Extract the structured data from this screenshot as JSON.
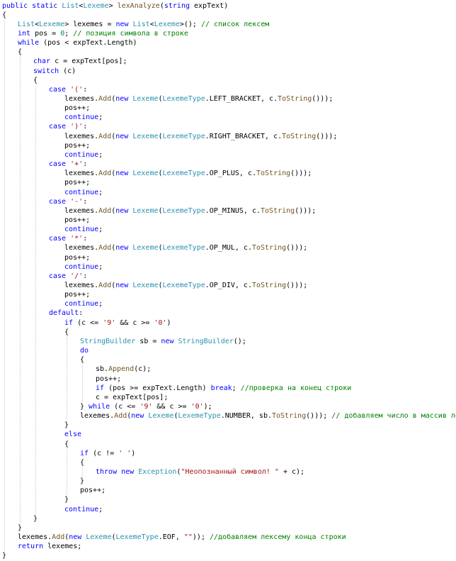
{
  "colors": {
    "background": "#ffffff",
    "plain": "#000000",
    "keyword": "#0000ff",
    "type": "#2b91af",
    "method": "#74531f",
    "string": "#a31515",
    "comment": "#008000",
    "number": "#098658",
    "guide": "#c8c8c8"
  },
  "code": {
    "lines": [
      {
        "indent": 0,
        "tokens": [
          [
            "public",
            "k"
          ],
          [
            " ",
            "p"
          ],
          [
            "static",
            "k"
          ],
          [
            " ",
            "p"
          ],
          [
            "List",
            "t"
          ],
          [
            "<",
            "p"
          ],
          [
            "Lexeme",
            "t"
          ],
          [
            "> ",
            "p"
          ],
          [
            "lexAnalyze",
            "m"
          ],
          [
            "(",
            "p"
          ],
          [
            "string",
            "k"
          ],
          [
            " expText)",
            "p"
          ]
        ]
      },
      {
        "indent": 0,
        "tokens": [
          [
            "{",
            "p"
          ]
        ]
      },
      {
        "indent": 1,
        "tokens": [
          [
            "List",
            "t"
          ],
          [
            "<",
            "p"
          ],
          [
            "Lexeme",
            "t"
          ],
          [
            "> lexemes = ",
            "p"
          ],
          [
            "new",
            "k"
          ],
          [
            " ",
            "p"
          ],
          [
            "List",
            "t"
          ],
          [
            "<",
            "p"
          ],
          [
            "Lexeme",
            "t"
          ],
          [
            ">(); ",
            "p"
          ],
          [
            "// список лексем",
            "c"
          ]
        ]
      },
      {
        "indent": 1,
        "tokens": [
          [
            "int",
            "k"
          ],
          [
            " pos = ",
            "p"
          ],
          [
            "0",
            "n"
          ],
          [
            "; ",
            "p"
          ],
          [
            "// позиция символа в строке",
            "c"
          ]
        ]
      },
      {
        "indent": 1,
        "tokens": [
          [
            "while",
            "k"
          ],
          [
            " (pos < expText.Length)",
            "p"
          ]
        ]
      },
      {
        "indent": 1,
        "tokens": [
          [
            "{",
            "p"
          ]
        ]
      },
      {
        "indent": 2,
        "tokens": [
          [
            "char",
            "k"
          ],
          [
            " c = expText[pos];",
            "p"
          ]
        ]
      },
      {
        "indent": 2,
        "tokens": [
          [
            "switch",
            "k"
          ],
          [
            " (c)",
            "p"
          ]
        ]
      },
      {
        "indent": 2,
        "tokens": [
          [
            "{",
            "p"
          ]
        ]
      },
      {
        "indent": 3,
        "tokens": [
          [
            "case",
            "k"
          ],
          [
            " ",
            "p"
          ],
          [
            "'('",
            "s"
          ],
          [
            ":",
            "p"
          ]
        ]
      },
      {
        "indent": 4,
        "tokens": [
          [
            "lexemes.",
            "p"
          ],
          [
            "Add",
            "m"
          ],
          [
            "(",
            "p"
          ],
          [
            "new",
            "k"
          ],
          [
            " ",
            "p"
          ],
          [
            "Lexeme",
            "t"
          ],
          [
            "(",
            "p"
          ],
          [
            "LexemeType",
            "t"
          ],
          [
            ".LEFT_BRACKET, c.",
            "p"
          ],
          [
            "ToString",
            "m"
          ],
          [
            "()));",
            "p"
          ]
        ]
      },
      {
        "indent": 4,
        "tokens": [
          [
            "pos++;",
            "p"
          ]
        ]
      },
      {
        "indent": 4,
        "tokens": [
          [
            "continue",
            "k"
          ],
          [
            ";",
            "p"
          ]
        ]
      },
      {
        "indent": 3,
        "tokens": [
          [
            "case",
            "k"
          ],
          [
            " ",
            "p"
          ],
          [
            "')'",
            "s"
          ],
          [
            ":",
            "p"
          ]
        ]
      },
      {
        "indent": 4,
        "tokens": [
          [
            "lexemes.",
            "p"
          ],
          [
            "Add",
            "m"
          ],
          [
            "(",
            "p"
          ],
          [
            "new",
            "k"
          ],
          [
            " ",
            "p"
          ],
          [
            "Lexeme",
            "t"
          ],
          [
            "(",
            "p"
          ],
          [
            "LexemeType",
            "t"
          ],
          [
            ".RIGHT_BRACKET, c.",
            "p"
          ],
          [
            "ToString",
            "m"
          ],
          [
            "()));",
            "p"
          ]
        ]
      },
      {
        "indent": 4,
        "tokens": [
          [
            "pos++;",
            "p"
          ]
        ]
      },
      {
        "indent": 4,
        "tokens": [
          [
            "continue",
            "k"
          ],
          [
            ";",
            "p"
          ]
        ]
      },
      {
        "indent": 3,
        "tokens": [
          [
            "case",
            "k"
          ],
          [
            " ",
            "p"
          ],
          [
            "'+'",
            "s"
          ],
          [
            ":",
            "p"
          ]
        ]
      },
      {
        "indent": 4,
        "tokens": [
          [
            "lexemes.",
            "p"
          ],
          [
            "Add",
            "m"
          ],
          [
            "(",
            "p"
          ],
          [
            "new",
            "k"
          ],
          [
            " ",
            "p"
          ],
          [
            "Lexeme",
            "t"
          ],
          [
            "(",
            "p"
          ],
          [
            "LexemeType",
            "t"
          ],
          [
            ".OP_PLUS, c.",
            "p"
          ],
          [
            "ToString",
            "m"
          ],
          [
            "()));",
            "p"
          ]
        ]
      },
      {
        "indent": 4,
        "tokens": [
          [
            "pos++;",
            "p"
          ]
        ]
      },
      {
        "indent": 4,
        "tokens": [
          [
            "continue",
            "k"
          ],
          [
            ";",
            "p"
          ]
        ]
      },
      {
        "indent": 3,
        "tokens": [
          [
            "case",
            "k"
          ],
          [
            " ",
            "p"
          ],
          [
            "'-'",
            "s"
          ],
          [
            ":",
            "p"
          ]
        ]
      },
      {
        "indent": 4,
        "tokens": [
          [
            "lexemes.",
            "p"
          ],
          [
            "Add",
            "m"
          ],
          [
            "(",
            "p"
          ],
          [
            "new",
            "k"
          ],
          [
            " ",
            "p"
          ],
          [
            "Lexeme",
            "t"
          ],
          [
            "(",
            "p"
          ],
          [
            "LexemeType",
            "t"
          ],
          [
            ".OP_MINUS, c.",
            "p"
          ],
          [
            "ToString",
            "m"
          ],
          [
            "()));",
            "p"
          ]
        ]
      },
      {
        "indent": 4,
        "tokens": [
          [
            "pos++;",
            "p"
          ]
        ]
      },
      {
        "indent": 4,
        "tokens": [
          [
            "continue",
            "k"
          ],
          [
            ";",
            "p"
          ]
        ]
      },
      {
        "indent": 3,
        "tokens": [
          [
            "case",
            "k"
          ],
          [
            " ",
            "p"
          ],
          [
            "'*'",
            "s"
          ],
          [
            ":",
            "p"
          ]
        ]
      },
      {
        "indent": 4,
        "tokens": [
          [
            "lexemes.",
            "p"
          ],
          [
            "Add",
            "m"
          ],
          [
            "(",
            "p"
          ],
          [
            "new",
            "k"
          ],
          [
            " ",
            "p"
          ],
          [
            "Lexeme",
            "t"
          ],
          [
            "(",
            "p"
          ],
          [
            "LexemeType",
            "t"
          ],
          [
            ".OP_MUL, c.",
            "p"
          ],
          [
            "ToString",
            "m"
          ],
          [
            "()));",
            "p"
          ]
        ]
      },
      {
        "indent": 4,
        "tokens": [
          [
            "pos++;",
            "p"
          ]
        ]
      },
      {
        "indent": 4,
        "tokens": [
          [
            "continue",
            "k"
          ],
          [
            ";",
            "p"
          ]
        ]
      },
      {
        "indent": 3,
        "tokens": [
          [
            "case",
            "k"
          ],
          [
            " ",
            "p"
          ],
          [
            "'/'",
            "s"
          ],
          [
            ":",
            "p"
          ]
        ]
      },
      {
        "indent": 4,
        "tokens": [
          [
            "lexemes.",
            "p"
          ],
          [
            "Add",
            "m"
          ],
          [
            "(",
            "p"
          ],
          [
            "new",
            "k"
          ],
          [
            " ",
            "p"
          ],
          [
            "Lexeme",
            "t"
          ],
          [
            "(",
            "p"
          ],
          [
            "LexemeType",
            "t"
          ],
          [
            ".OP_DIV, c.",
            "p"
          ],
          [
            "ToString",
            "m"
          ],
          [
            "()));",
            "p"
          ]
        ]
      },
      {
        "indent": 4,
        "tokens": [
          [
            "pos++;",
            "p"
          ]
        ]
      },
      {
        "indent": 4,
        "tokens": [
          [
            "continue",
            "k"
          ],
          [
            ";",
            "p"
          ]
        ]
      },
      {
        "indent": 3,
        "tokens": [
          [
            "default",
            "k"
          ],
          [
            ":",
            "p"
          ]
        ]
      },
      {
        "indent": 4,
        "tokens": [
          [
            "if",
            "k"
          ],
          [
            " (c <= ",
            "p"
          ],
          [
            "'9'",
            "s"
          ],
          [
            " && c >= ",
            "p"
          ],
          [
            "'0'",
            "s"
          ],
          [
            ")",
            "p"
          ]
        ]
      },
      {
        "indent": 4,
        "tokens": [
          [
            "{",
            "p"
          ]
        ]
      },
      {
        "indent": 5,
        "tokens": [
          [
            "StringBuilder",
            "t"
          ],
          [
            " sb = ",
            "p"
          ],
          [
            "new",
            "k"
          ],
          [
            " ",
            "p"
          ],
          [
            "StringBuilder",
            "t"
          ],
          [
            "();",
            "p"
          ]
        ]
      },
      {
        "indent": 5,
        "tokens": [
          [
            "do",
            "k"
          ]
        ]
      },
      {
        "indent": 5,
        "tokens": [
          [
            "{",
            "p"
          ]
        ]
      },
      {
        "indent": 6,
        "tokens": [
          [
            "sb.",
            "p"
          ],
          [
            "Append",
            "m"
          ],
          [
            "(c);",
            "p"
          ]
        ]
      },
      {
        "indent": 6,
        "tokens": [
          [
            "pos++;",
            "p"
          ]
        ]
      },
      {
        "indent": 6,
        "tokens": [
          [
            "if",
            "k"
          ],
          [
            " (pos >= expText.Length) ",
            "p"
          ],
          [
            "break",
            "k"
          ],
          [
            "; ",
            "p"
          ],
          [
            "//проверка на конец строки",
            "c"
          ]
        ]
      },
      {
        "indent": 6,
        "tokens": [
          [
            "c = expText[pos];",
            "p"
          ]
        ]
      },
      {
        "indent": 5,
        "tokens": [
          [
            "} ",
            "p"
          ],
          [
            "while",
            "k"
          ],
          [
            " (c <= ",
            "p"
          ],
          [
            "'9'",
            "s"
          ],
          [
            " && c >= ",
            "p"
          ],
          [
            "'0'",
            "s"
          ],
          [
            ");",
            "p"
          ]
        ]
      },
      {
        "indent": 5,
        "tokens": [
          [
            "lexemes.",
            "p"
          ],
          [
            "Add",
            "m"
          ],
          [
            "(",
            "p"
          ],
          [
            "new",
            "k"
          ],
          [
            " ",
            "p"
          ],
          [
            "Lexeme",
            "t"
          ],
          [
            "(",
            "p"
          ],
          [
            "LexemeType",
            "t"
          ],
          [
            ".NUMBER, sb.",
            "p"
          ],
          [
            "ToString",
            "m"
          ],
          [
            "())); ",
            "p"
          ],
          [
            "// добавляем число в массив лексем",
            "c"
          ]
        ]
      },
      {
        "indent": 4,
        "tokens": [
          [
            "}",
            "p"
          ]
        ]
      },
      {
        "indent": 4,
        "tokens": [
          [
            "else",
            "k"
          ]
        ]
      },
      {
        "indent": 4,
        "tokens": [
          [
            "{",
            "p"
          ]
        ]
      },
      {
        "indent": 5,
        "tokens": [
          [
            "if",
            "k"
          ],
          [
            " (c != ",
            "p"
          ],
          [
            "' '",
            "s"
          ],
          [
            ")",
            "p"
          ]
        ]
      },
      {
        "indent": 5,
        "tokens": [
          [
            "{",
            "p"
          ]
        ]
      },
      {
        "indent": 6,
        "tokens": [
          [
            "throw",
            "k"
          ],
          [
            " ",
            "p"
          ],
          [
            "new",
            "k"
          ],
          [
            " ",
            "p"
          ],
          [
            "Exception",
            "t"
          ],
          [
            "(",
            "p"
          ],
          [
            "\"Неопознанный символ! \"",
            "s"
          ],
          [
            " + c);",
            "p"
          ]
        ]
      },
      {
        "indent": 5,
        "tokens": [
          [
            "}",
            "p"
          ]
        ]
      },
      {
        "indent": 5,
        "tokens": [
          [
            "pos++;",
            "p"
          ]
        ]
      },
      {
        "indent": 4,
        "tokens": [
          [
            "}",
            "p"
          ]
        ]
      },
      {
        "indent": 4,
        "tokens": [
          [
            "continue",
            "k"
          ],
          [
            ";",
            "p"
          ]
        ]
      },
      {
        "indent": 2,
        "tokens": [
          [
            "}",
            "p"
          ]
        ]
      },
      {
        "indent": 1,
        "tokens": [
          [
            "}",
            "p"
          ]
        ]
      },
      {
        "indent": 1,
        "tokens": [
          [
            "lexemes.",
            "p"
          ],
          [
            "Add",
            "m"
          ],
          [
            "(",
            "p"
          ],
          [
            "new",
            "k"
          ],
          [
            " ",
            "p"
          ],
          [
            "Lexeme",
            "t"
          ],
          [
            "(",
            "p"
          ],
          [
            "LexemeType",
            "t"
          ],
          [
            ".EOF, ",
            "p"
          ],
          [
            "\"\"",
            "s"
          ],
          [
            ")); ",
            "p"
          ],
          [
            "//добавляем лексему конца строки",
            "c"
          ]
        ]
      },
      {
        "indent": 1,
        "tokens": [
          [
            "return",
            "k"
          ],
          [
            " lexemes;",
            "p"
          ]
        ]
      },
      {
        "indent": 0,
        "tokens": [
          [
            "}",
            "p"
          ]
        ]
      }
    ]
  }
}
